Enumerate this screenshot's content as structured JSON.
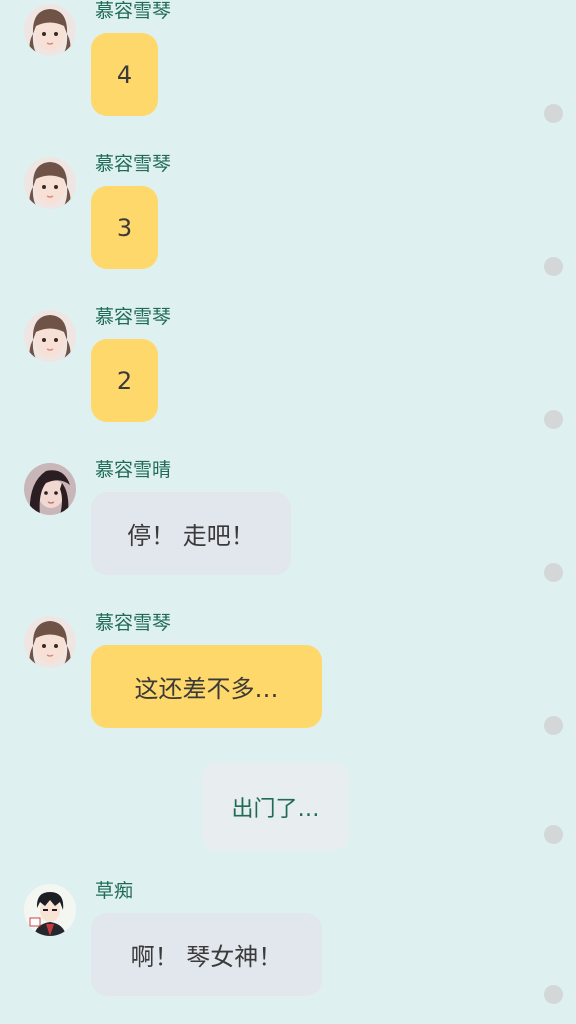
{
  "colors": {
    "background": "#dff0f1",
    "sender_name": "#1f6b57",
    "bubble_yellow": "#ffd86b",
    "bubble_gray": "#e2e7ee",
    "status_dot": "#d3d7d8"
  },
  "messages": [
    {
      "sender": "慕容雪琴",
      "text": "4",
      "bubble": "yellow",
      "avatar": "girl-bangs-avatar"
    },
    {
      "sender": "慕容雪琴",
      "text": "3",
      "bubble": "yellow",
      "avatar": "girl-bangs-avatar"
    },
    {
      "sender": "慕容雪琴",
      "text": "2",
      "bubble": "yellow",
      "avatar": "girl-bangs-avatar"
    },
    {
      "sender": "慕容雪晴",
      "text": "停！ 走吧！",
      "bubble": "gray",
      "avatar": "girl-dark-hair-avatar"
    },
    {
      "sender": "慕容雪琴",
      "text": "这还差不多…",
      "bubble": "yellow",
      "avatar": "girl-bangs-avatar"
    },
    {
      "sender": "",
      "text": "出门了…",
      "bubble": "system",
      "avatar": ""
    },
    {
      "sender": "草痴",
      "text": "啊！ 琴女神！",
      "bubble": "gray",
      "avatar": "anime-boy-avatar"
    }
  ]
}
